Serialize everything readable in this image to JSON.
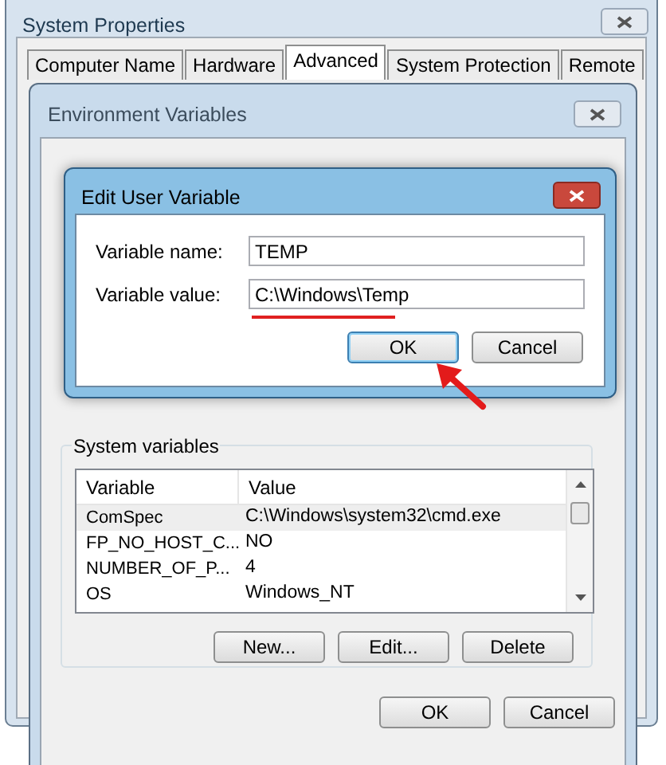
{
  "system_properties": {
    "title": "System Properties",
    "tabs": [
      {
        "label": "Computer Name",
        "selected": false
      },
      {
        "label": "Hardware",
        "selected": false
      },
      {
        "label": "Advanced",
        "selected": true
      },
      {
        "label": "System Protection",
        "selected": false
      },
      {
        "label": "Remote",
        "selected": false
      }
    ]
  },
  "environment_variables": {
    "title": "Environment Variables",
    "system_variables": {
      "title": "System variables",
      "columns": [
        "Variable",
        "Value"
      ],
      "rows": [
        {
          "variable": "ComSpec",
          "value": "C:\\Windows\\system32\\cmd.exe",
          "selected": true
        },
        {
          "variable": "FP_NO_HOST_C...",
          "value": "NO",
          "selected": false
        },
        {
          "variable": "NUMBER_OF_P...",
          "value": "4",
          "selected": false
        },
        {
          "variable": "OS",
          "value": "Windows_NT",
          "selected": false
        }
      ],
      "buttons": [
        "New...",
        "Edit...",
        "Delete"
      ]
    },
    "buttons": [
      "OK",
      "Cancel"
    ]
  },
  "edit_user_variable": {
    "title": "Edit User Variable",
    "fields": [
      {
        "label": "Variable name:",
        "value": "TEMP"
      },
      {
        "label": "Variable value:",
        "value": "C:\\Windows\\Temp"
      }
    ],
    "buttons": [
      {
        "label": "OK",
        "focused": true
      },
      {
        "label": "Cancel",
        "focused": false
      }
    ]
  }
}
